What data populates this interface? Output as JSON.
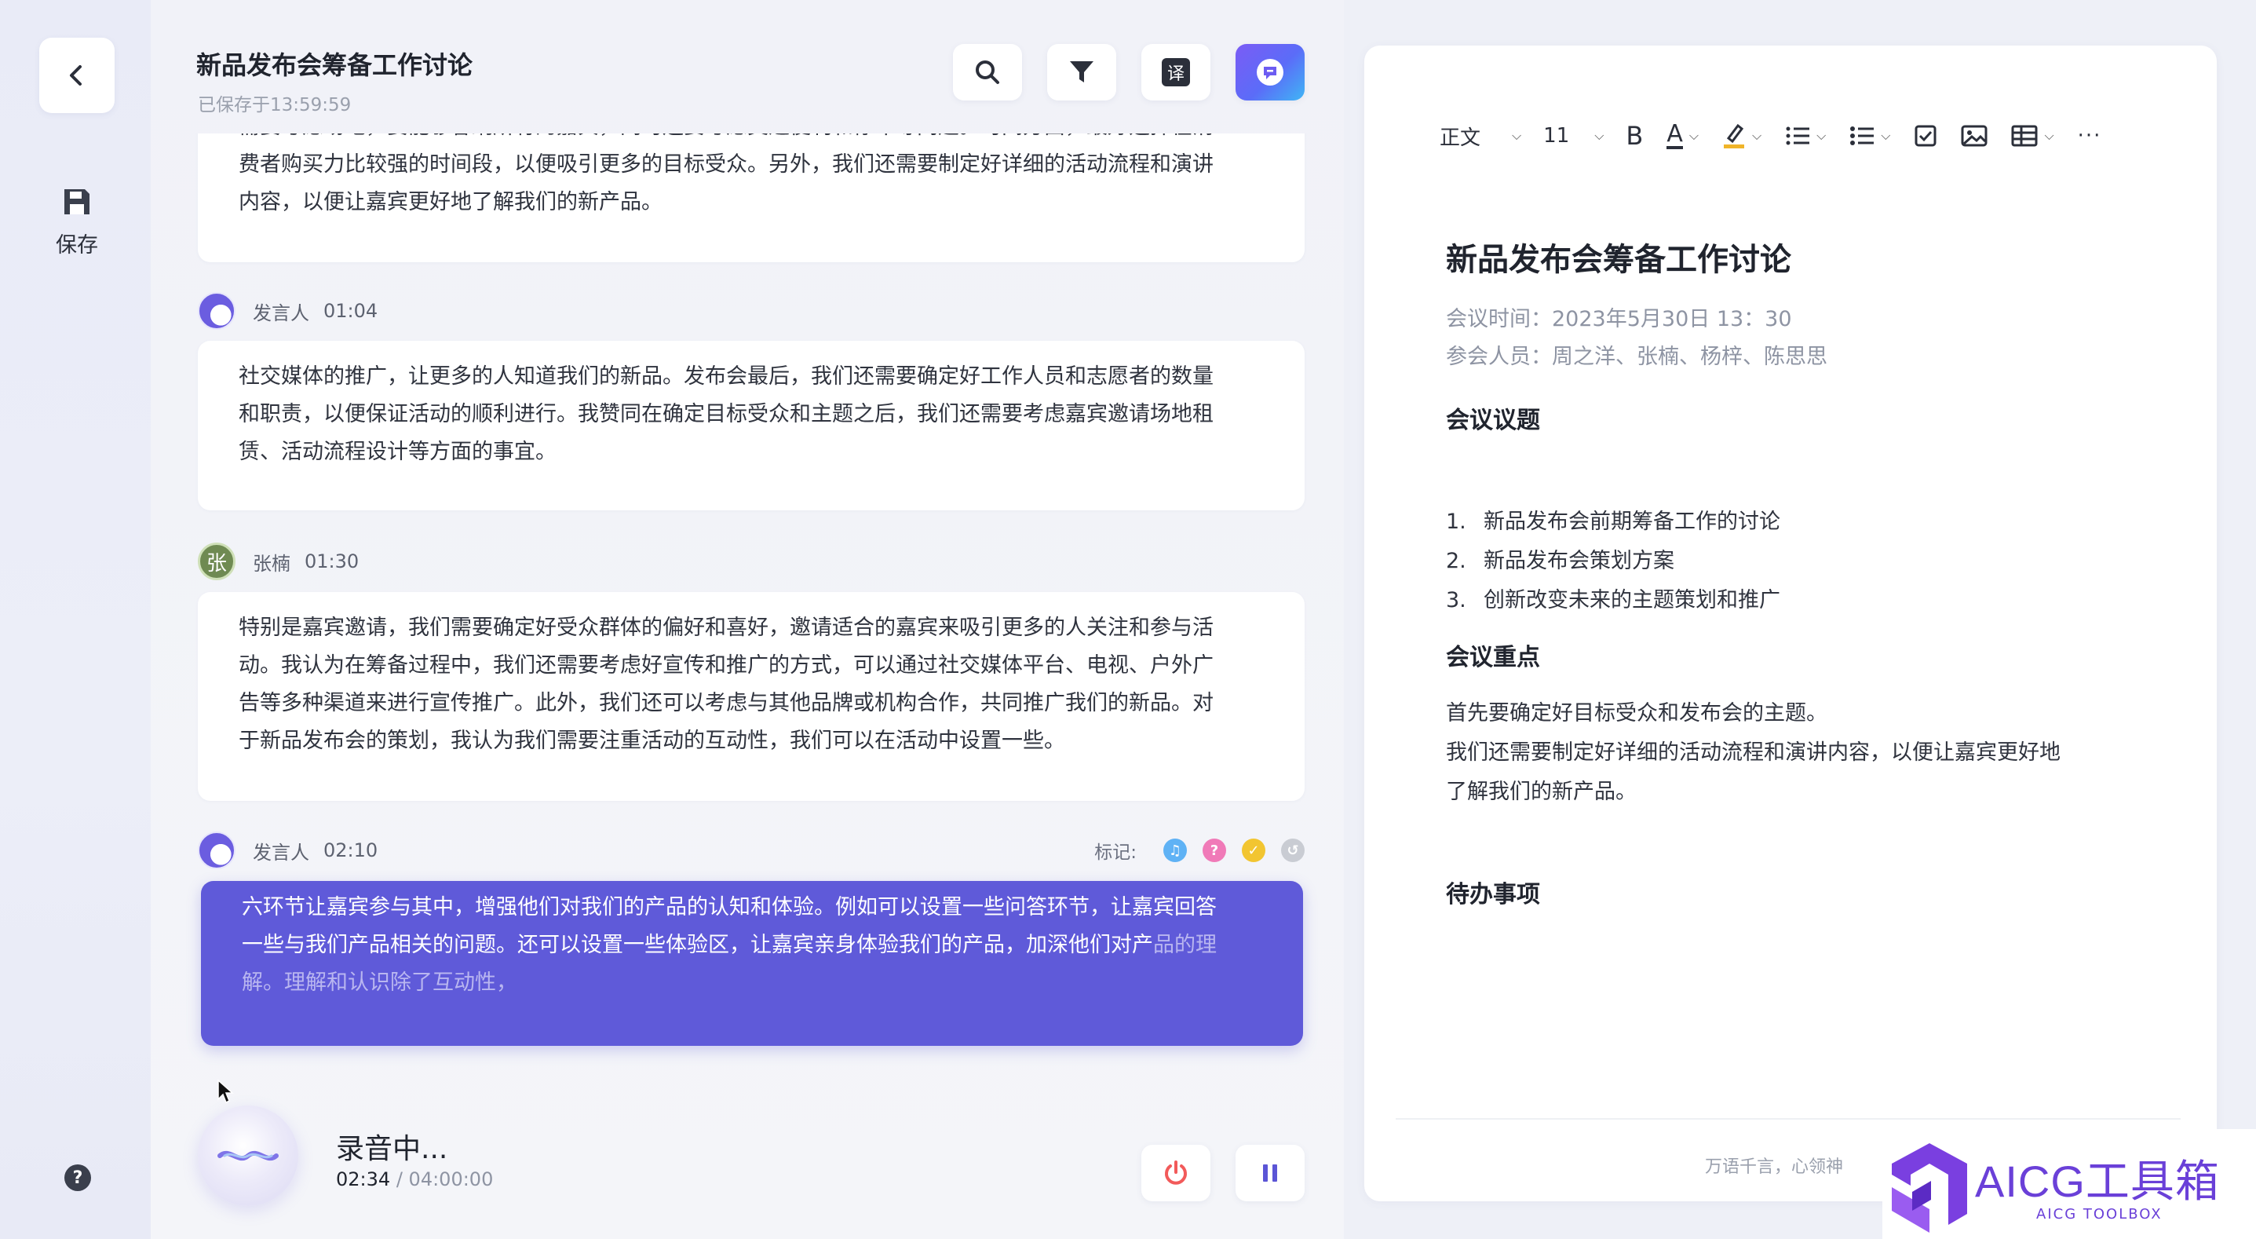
{
  "nav": {
    "save_label": "保存",
    "help_glyph": "?"
  },
  "header": {
    "title": "新品发布会筹备工作讨论",
    "saved_status": "已保存于13:59:59",
    "tools": [
      "search-icon",
      "filter-icon",
      "translate-icon",
      "ai-assistant-icon"
    ],
    "translate_glyph": "译"
  },
  "transcript": {
    "top_card_lines": [
      "需要考虑场地，要能够容纳所有的嘉宾，同时还要考虑交通便利和停车等问题。时间方面，最好选择在消",
      "费者购买力比较强的时间段，以便吸引更多的目标受众。另外，我们还需要制定好详细的活动流程和演讲",
      "内容，以便让嘉宾更好地了解我们的新产品。"
    ],
    "entries": [
      {
        "speaker": "发言人",
        "time": "01:04",
        "lines": [
          "社交媒体的推广，让更多的人知道我们的新品。发布会最后，我们还需要确定好工作人员和志愿者的数量",
          "和职责，以便保证活动的顺利进行。我赞同在确定目标受众和主题之后，我们还需要考虑嘉宾邀请场地租",
          "赁、活动流程设计等方面的事宜。"
        ]
      },
      {
        "speaker": "张楠",
        "time": "01:30",
        "avatar_text": "张",
        "lines": [
          "特别是嘉宾邀请，我们需要确定好受众群体的偏好和喜好，邀请适合的嘉宾来吸引更多的人关注和参与活",
          "动。我认为在筹备过程中，我们还需要考虑好宣传和推广的方式，可以通过社交媒体平台、电视、户外广",
          "告等多种渠道来进行宣传推广。此外，我们还可以考虑与其他品牌或机构合作，共同推广我们的新品。对",
          "于新品发布会的策划，我认为我们需要注重活动的互动性，我们可以在活动中设置一些。"
        ]
      },
      {
        "speaker": "发言人",
        "time": "02:10",
        "marks_label": "标记:",
        "line1": "六环节让嘉宾参与其中，增强他们对我们的产品的认知和体验。例如可以设置一些问答环节，让嘉宾回答",
        "line2_main": "一些与我们产品相关的问题。还可以设置一些体验区，让嘉宾亲身体验我们的产品，加深他们对产",
        "line2_fade": "品的理",
        "line3": "解。理解和认识除了互动性，"
      }
    ],
    "mark_colors": [
      "#5fb2f5",
      "#f07ab8",
      "#f2c531",
      "#c9ccd3"
    ],
    "mark_icons": [
      "bell-mark-icon",
      "question-mark-icon",
      "check-mark-icon",
      "undo-mark-icon"
    ]
  },
  "recorder": {
    "status": "录音中...",
    "elapsed": "02:34",
    "separator": "/",
    "total": "04:00:00",
    "stop_color": "#f25a5a",
    "pause_color": "#5b55d6"
  },
  "editor": {
    "toolbar": {
      "style": "正文",
      "font_size": "11",
      "bold": "B",
      "font_color_glyph": "A"
    },
    "title": "新品发布会筹备工作讨论",
    "meeting_time": "会议时间：2023年5月30日 13：30",
    "attendees": "参会人员：周之洋、张楠、杨梓、陈思思",
    "agenda_heading": "会议议题",
    "agenda": [
      {
        "num": "1.",
        "text": "新品发布会前期筹备工作的讨论"
      },
      {
        "num": "2.",
        "text": "新品发布会策划方案"
      },
      {
        "num": "3.",
        "text": "创新改变未来的主题策划和推广"
      }
    ],
    "keypoints_heading": "会议重点",
    "keypoints": [
      "首先要确定好目标受众和发布会的主题。",
      "我们还需要制定好详细的活动流程和演讲内容，以便让嘉宾更好地",
      "了解我们的新产品。"
    ],
    "todo_heading": "待办事项",
    "footer": "万语千言，心领神"
  },
  "watermark": {
    "text": "AICG工具箱",
    "sub": "AICG TOOLBOX"
  }
}
